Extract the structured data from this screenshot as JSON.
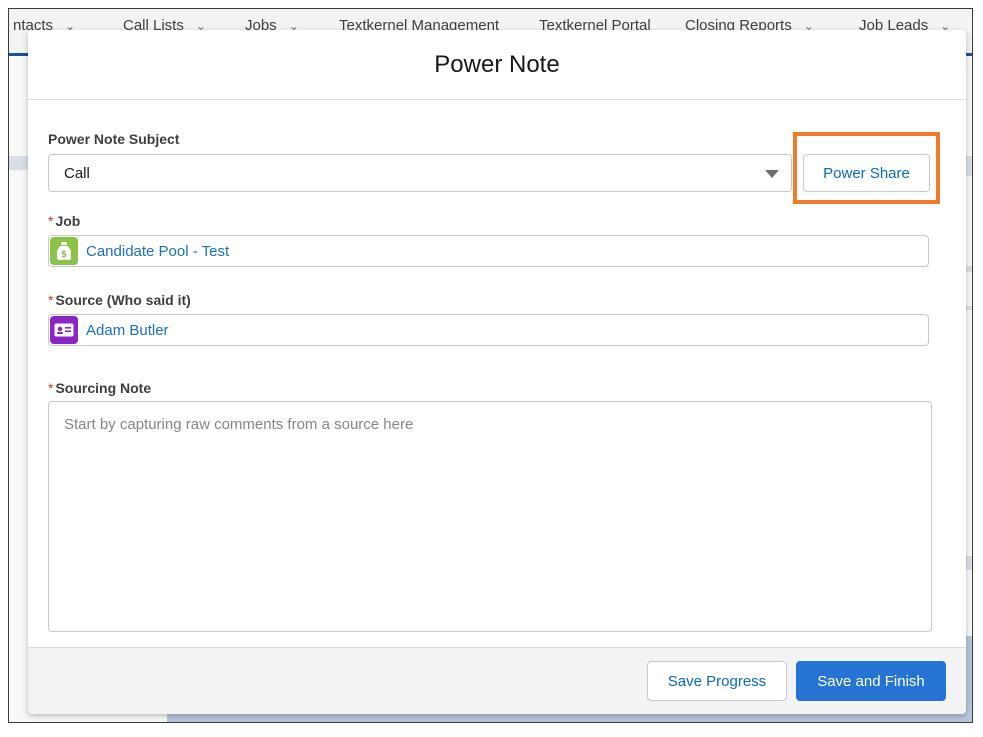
{
  "background_nav": {
    "tabs": [
      {
        "label": "ntacts"
      },
      {
        "label": "Call Lists"
      },
      {
        "label": "Jobs"
      },
      {
        "label": "Textkernel Management"
      },
      {
        "label": "Textkernel Portal"
      },
      {
        "label": "Closing Reports"
      },
      {
        "label": "Job Leads"
      }
    ]
  },
  "modal": {
    "title": "Power Note",
    "subject": {
      "label": "Power Note Subject",
      "value": "Call"
    },
    "power_share_label": "Power Share",
    "job": {
      "required_mark": "*",
      "label": "Job",
      "value": "Candidate Pool - Test",
      "icon": "money-bag-icon"
    },
    "source": {
      "required_mark": "*",
      "label": "Source (Who said it)",
      "value": "Adam Butler",
      "icon": "contact-card-icon"
    },
    "sourcing_note": {
      "required_mark": "*",
      "label": "Sourcing Note",
      "placeholder": "Start by capturing raw comments from a source here"
    },
    "footer": {
      "save_progress_label": "Save Progress",
      "save_finish_label": "Save and Finish"
    }
  },
  "colors": {
    "brand": "#2574d4",
    "highlight": "#f07b2a",
    "required": "#c23934",
    "job_icon_bg": "#8bc34a",
    "contact_icon_bg": "#8a25c6"
  }
}
